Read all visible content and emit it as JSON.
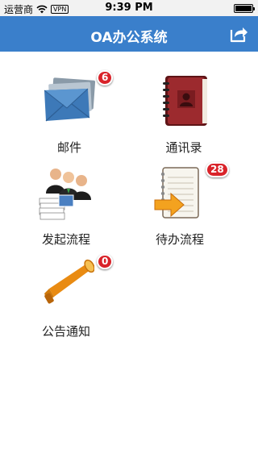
{
  "status_bar": {
    "carrier": "运营商",
    "vpn": "VPN",
    "time": "9:39 PM",
    "wifi_icon": "wifi-icon",
    "battery_icon": "battery-icon"
  },
  "nav": {
    "title": "OA办公系统",
    "share_icon": "share-icon",
    "color": "#3a7fcb"
  },
  "menu": {
    "mail": {
      "label": "邮件",
      "badge": "6",
      "icon": "envelopes-icon"
    },
    "contacts": {
      "label": "通讯录",
      "icon": "address-book-icon"
    },
    "start_process": {
      "label": "发起流程",
      "icon": "people-documents-icon"
    },
    "pending_process": {
      "label": "待办流程",
      "badge": "28",
      "icon": "notepad-arrow-icon"
    },
    "notice": {
      "label": "公告通知",
      "badge": "0",
      "icon": "megaphone-icon"
    }
  },
  "badge_color": "#d9232a"
}
